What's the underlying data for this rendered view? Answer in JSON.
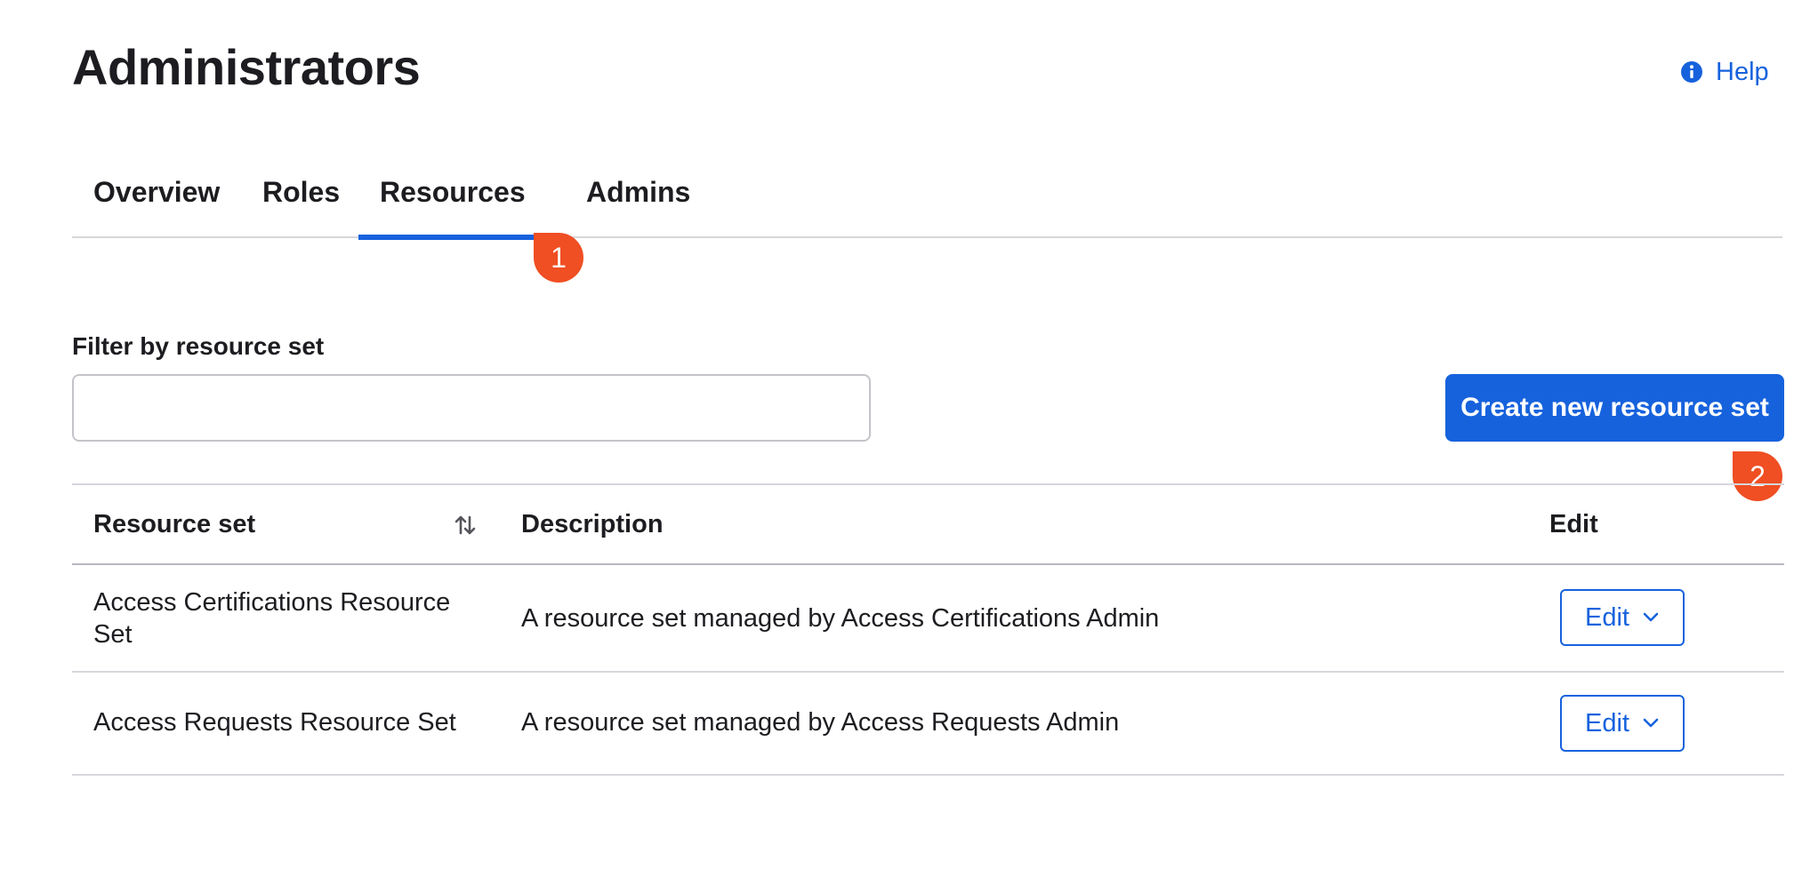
{
  "header": {
    "title": "Administrators",
    "help_label": "Help",
    "help_icon": "info-icon"
  },
  "tabs": [
    {
      "label": "Overview",
      "active": false
    },
    {
      "label": "Roles",
      "active": false
    },
    {
      "label": "Resources",
      "active": true
    },
    {
      "label": "Admins",
      "active": false
    }
  ],
  "markers": [
    "1",
    "2"
  ],
  "filter": {
    "label": "Filter by resource set",
    "value": "",
    "placeholder": ""
  },
  "actions": {
    "create_label": "Create new resource set"
  },
  "table": {
    "columns": {
      "resource_set": "Resource set",
      "description": "Description",
      "edit": "Edit"
    },
    "sort_icon": "sort-icon",
    "rows": [
      {
        "resource_set": "Access Certifications Resource Set",
        "description": "A resource set managed by Access Certifications Admin",
        "edit_label": "Edit"
      },
      {
        "resource_set": "Access Requests Resource Set",
        "description": "A resource set managed by Access Requests Admin",
        "edit_label": "Edit"
      }
    ]
  },
  "colors": {
    "accent": "#1662dd",
    "marker": "#f04e23",
    "text": "#1d1d21",
    "divider": "#d7d7dc"
  }
}
